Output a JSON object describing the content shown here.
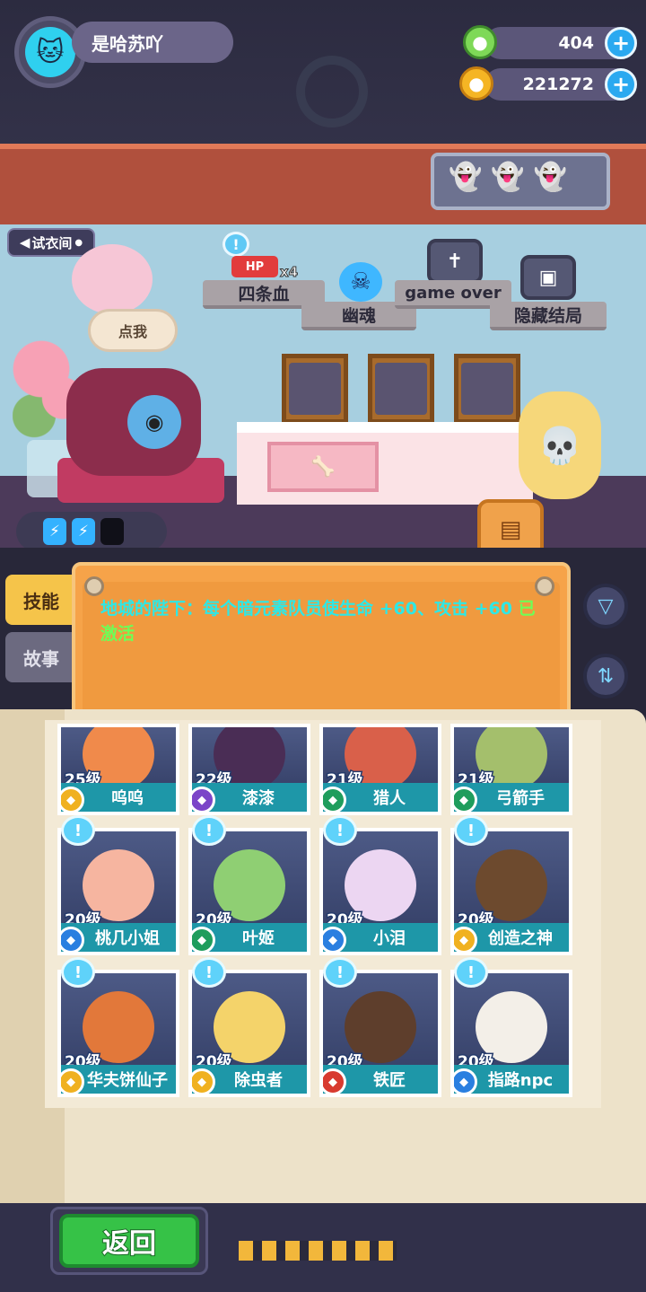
{
  "player": {
    "name": "是哈苏吖",
    "avatar_icon": "cat-face-icon"
  },
  "currency": {
    "gems": "404",
    "coins": "221272"
  },
  "room": {
    "fitting_room_label": "试衣间",
    "click_me": "点我",
    "signs": {
      "four_hp": "四条血",
      "ghost": "幽魂",
      "game_over": "game over",
      "hidden_ending": "隐藏结局"
    },
    "hp_label": "HP",
    "hp_multiplier": "x4"
  },
  "energy": {
    "filled": 2,
    "total": 3
  },
  "side_tabs": {
    "skill": "技能",
    "story": "故事"
  },
  "notice": {
    "text": "地城的陛下：每个暗元素队员使生命 +60、攻击 +60",
    "status": "已激活"
  },
  "characters": [
    {
      "level": "25级",
      "name": "呜呜",
      "element": "gold",
      "new": false,
      "color": "#f08a4b"
    },
    {
      "level": "22级",
      "name": "漆漆",
      "element": "purple",
      "new": false,
      "color": "#4a2d55"
    },
    {
      "level": "21级",
      "name": "猎人",
      "element": "green",
      "new": false,
      "color": "#d9604a"
    },
    {
      "level": "21级",
      "name": "弓箭手",
      "element": "green",
      "new": false,
      "color": "#a4bf6c"
    },
    {
      "level": "20级",
      "name": "桃几小姐",
      "element": "blue",
      "new": true,
      "color": "#f6b5a0"
    },
    {
      "level": "20级",
      "name": "叶姬",
      "element": "green",
      "new": true,
      "color": "#8fcf73"
    },
    {
      "level": "20级",
      "name": "小泪",
      "element": "blue",
      "new": true,
      "color": "#ecd6f2"
    },
    {
      "level": "20级",
      "name": "创造之神",
      "element": "gold",
      "new": true,
      "color": "#6d4a2e"
    },
    {
      "level": "20级",
      "name": "华夫饼仙子",
      "element": "gold",
      "new": true,
      "color": "#e2783a"
    },
    {
      "level": "20级",
      "name": "除虫者",
      "element": "gold",
      "new": true,
      "color": "#f4d36a"
    },
    {
      "level": "20级",
      "name": "铁匠",
      "element": "red",
      "new": true,
      "color": "#5e3e2c"
    },
    {
      "level": "20级",
      "name": "指路npc",
      "element": "blue",
      "new": true,
      "color": "#f3efe8"
    }
  ],
  "element_colors": {
    "gold": "#f0b120",
    "purple": "#7b45c8",
    "green": "#1f9d5d",
    "blue": "#2a7fe0",
    "red": "#d83a2f"
  },
  "back_button": "返回"
}
